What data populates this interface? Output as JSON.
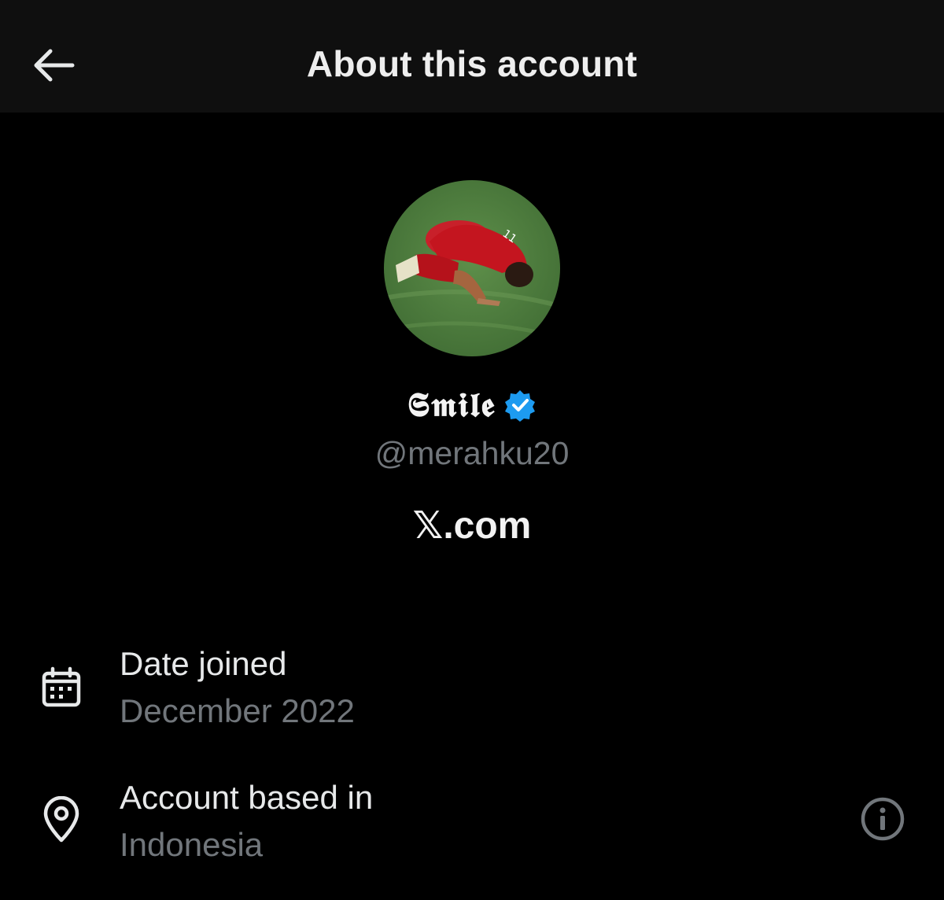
{
  "header": {
    "title": "About this account",
    "back_icon": "arrow-left-icon"
  },
  "profile": {
    "display_name": "𝕾𝖒𝖎𝖑𝖊",
    "verified_icon": "verified-badge-icon",
    "verified_color": "#1d9bf0",
    "handle": "@merahku20",
    "domain": "𝕏.com"
  },
  "details": {
    "date_joined": {
      "icon": "calendar-icon",
      "label": "Date joined",
      "value": "December 2022"
    },
    "account_based_in": {
      "icon": "location-pin-icon",
      "label": "Account based in",
      "value": "Indonesia",
      "info_icon": "info-icon"
    }
  },
  "colors": {
    "background": "#000000",
    "header_background": "#0f0f0f",
    "primary_text": "#e7e9ea",
    "secondary_text": "#71767b"
  }
}
